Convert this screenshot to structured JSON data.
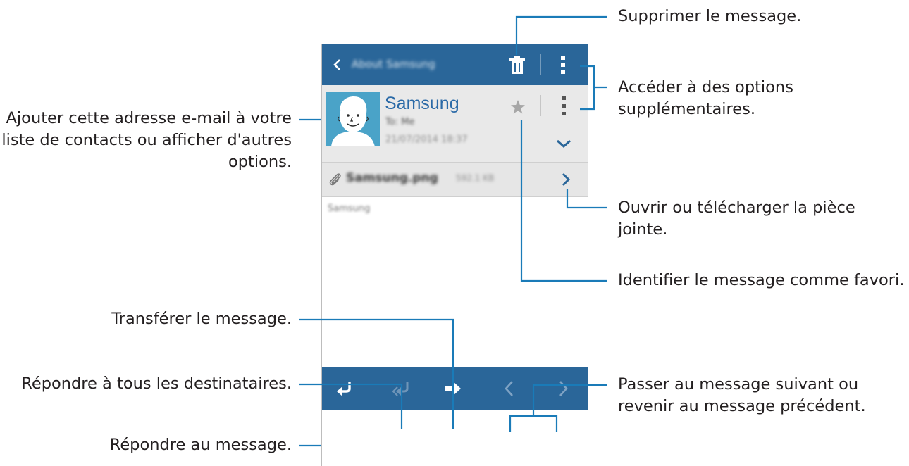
{
  "email": {
    "subject": "About Samsung",
    "sender_name": "Samsung",
    "to": "To: Me",
    "date": "21/07/2014 18:37",
    "attachment_name": "Samsung.png",
    "attachment_size": "592.1 KB",
    "body": "Samsung"
  },
  "icons": {
    "back": "chevron-left-icon",
    "delete": "trash-icon",
    "more": "more-vertical-icon",
    "favorite": "star-icon",
    "expand": "chevron-down-icon",
    "attachment": "paperclip-icon",
    "open_attachment": "chevron-right-icon",
    "reply": "reply-icon",
    "reply_all": "reply-all-icon",
    "forward": "forward-arrow-icon",
    "previous": "chevron-left-icon",
    "next": "chevron-right-icon"
  },
  "annotations": {
    "delete": "Supprimer le message.",
    "more_line1": "Accéder à des options",
    "more_line2": "supplémentaires.",
    "contact_line1": "Ajouter cette adresse e-mail à votre",
    "contact_line2": "liste de contacts ou afficher d'autres",
    "contact_line3": "options.",
    "attachment_line1": "Ouvrir ou télécharger la pièce",
    "attachment_line2": "jointe.",
    "favorite": "Identifier le message comme favori.",
    "forward": "Transférer le message.",
    "reply_all": "Répondre à tous les destinataires.",
    "reply": "Répondre au message.",
    "navigate_line1": "Passer au message suivant ou",
    "navigate_line2": "revenir au message précédent."
  },
  "colors": {
    "app_bar": "#2a6699",
    "sender_name": "#2b6aa7",
    "callout_line": "#1a7bb8",
    "header_background": "#e9e9e9"
  }
}
